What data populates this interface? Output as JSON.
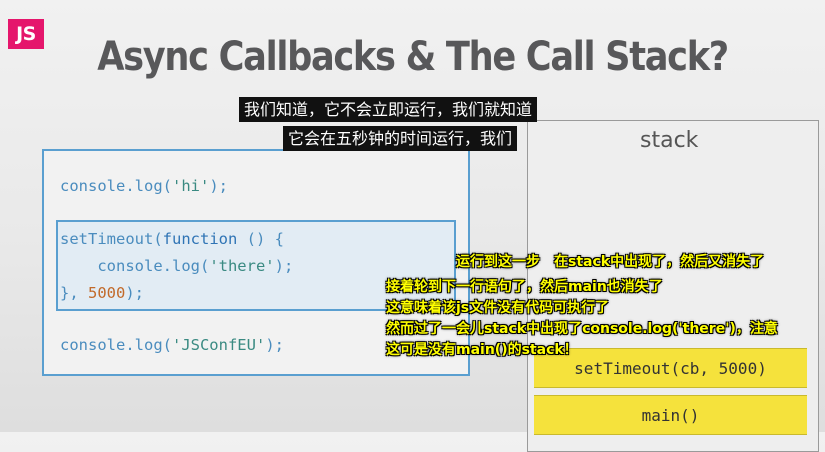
{
  "badge": "JS",
  "title": "Async Callbacks & The Call Stack?",
  "subtitles": [
    "我们知道，它不会立即运行，我们就知道",
    "它会在五秒钟的时间运行，我们"
  ],
  "stack": {
    "label": "stack",
    "frames": [
      "setTimeout(cb, 5000)",
      "main()"
    ]
  },
  "code": {
    "line1": {
      "fn": "console.log(",
      "str": "'hi'",
      "end": ");"
    },
    "line2": {
      "fn": "setTimeout(",
      "kw": "function",
      "rest": " () {"
    },
    "line3": {
      "indent": "    ",
      "fn": "console.log(",
      "str": "'there'",
      "end": ");"
    },
    "line4": {
      "start": "}, ",
      "num": "5000",
      "end": ");"
    },
    "line5": {
      "fn": "console.log(",
      "str": "'JSConfEU'",
      "end": ");"
    }
  },
  "annotations": [
    "运行到这一步　在stack中出现了，然后又消失了",
    "接着轮到下一行语句了，然后main也消失了",
    "这意味着该js文件没有代码可执行了",
    "然而过了一会儿stack中出现了console.log('there')，注意",
    "这可是没有main()的stack！"
  ]
}
